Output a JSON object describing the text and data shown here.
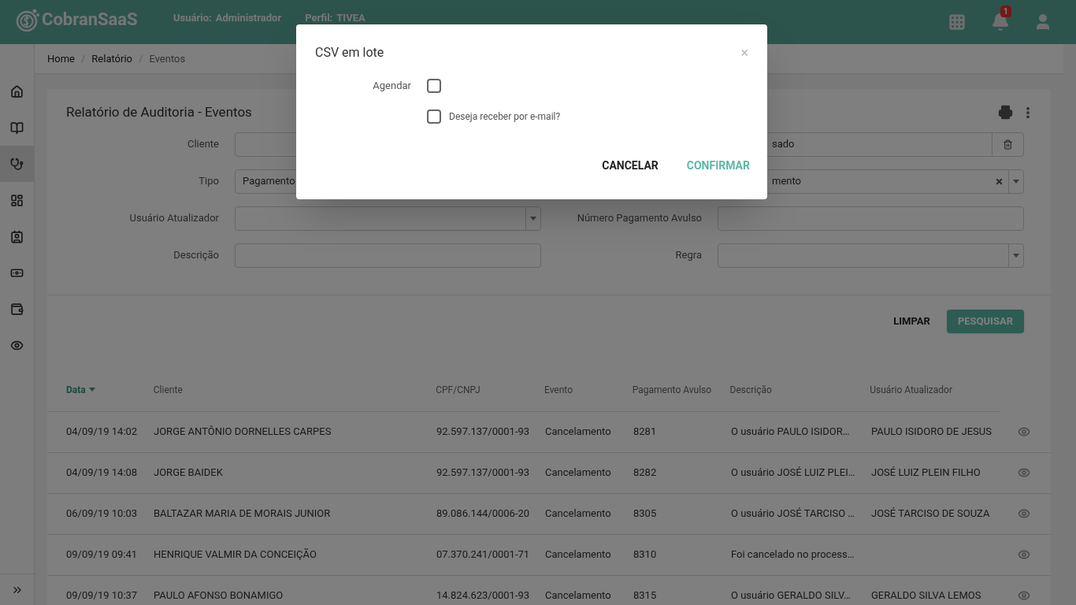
{
  "header": {
    "logo": "CobranSaaS",
    "user_label": "Usuário:",
    "user_value": "Administrador",
    "profile_label": "Perfil:",
    "profile_value": "TIVEA",
    "notification_count": "1"
  },
  "sidebar": {
    "items": [
      {
        "selected": false
      },
      {
        "selected": false
      },
      {
        "selected": true
      },
      {
        "selected": false
      },
      {
        "selected": false
      },
      {
        "selected": false
      },
      {
        "selected": false
      },
      {
        "selected": false
      }
    ]
  },
  "breadcrumb": {
    "separator": "/",
    "items": [
      "Home",
      "Relatório",
      "Eventos"
    ]
  },
  "card": {
    "title": "Relatório de Auditoria - Eventos"
  },
  "filters": [
    {
      "label": "Cliente",
      "kind": "text"
    },
    {
      "value": "sado",
      "kind": "removable"
    },
    {
      "label": "Tipo",
      "value": "Pagamento",
      "kind": "select"
    },
    {
      "value": "mento",
      "kind": "clearable_select"
    },
    {
      "label": "Usuário Atualizador",
      "kind": "select"
    },
    {
      "label": "Número Pagamento Avulso",
      "kind": "text"
    },
    {
      "label": "Descrição",
      "kind": "text"
    },
    {
      "label": "Regra",
      "kind": "select"
    }
  ],
  "actions": [
    {
      "label": "LIMPAR",
      "kind": "flat"
    },
    {
      "label": "PESQUISAR",
      "kind": "raised"
    }
  ],
  "table": {
    "columns": [
      {
        "label": "Data",
        "sorted": true
      },
      {
        "label": "Cliente",
        "sorted": false
      },
      {
        "label": "CPF/CNPJ",
        "sorted": false
      },
      {
        "label": "Evento",
        "sorted": false
      },
      {
        "label": "Pagamento Avulso",
        "sorted": false
      },
      {
        "label": "Descrição",
        "sorted": false
      },
      {
        "label": "Usuário Atualizador",
        "sorted": false
      }
    ],
    "rows": [
      [
        "04/09/19 14:02",
        "JORGE ANTÔNIO DORNELLES CARPES",
        "92.597.137/0001-93",
        "Cancelamento",
        "8281",
        "O usuário PAULO ISIDOR…",
        "PAULO ISIDORO DE JESUS"
      ],
      [
        "04/09/19 14:08",
        "JORGE BAIDEK",
        "92.597.137/0001-93",
        "Cancelamento",
        "8282",
        "O usuário JOSÉ LUIZ PLEI…",
        "JOSÉ LUIZ PLEIN FILHO"
      ],
      [
        "06/09/19 10:03",
        "BALTAZAR MARIA DE MORAIS JUNIOR",
        "89.086.144/0006-20",
        "Cancelamento",
        "8305",
        "O usuário JOSÉ TARCISO …",
        "JOSÉ TARCISO DE SOUZA"
      ],
      [
        "09/09/19 09:41",
        "HENRIQUE VALMIR DA CONCEIÇÃO",
        "07.370.241/0001-71",
        "Cancelamento",
        "8310",
        "Foi cancelado no process…",
        ""
      ],
      [
        "09/09/19 10:37",
        "PAULO AFONSO BONAMIGO",
        "14.824.623/0001-93",
        "Cancelamento",
        "8315",
        "O usuário GERALDO SILV…",
        "GERALDO SILVA LEMOS"
      ]
    ]
  },
  "modal": {
    "title": "CSV em lote",
    "close": "×",
    "options": [
      {
        "label": "Agendar",
        "kind": "labeled",
        "checked": false
      },
      {
        "label": "Deseja receber por e-mail?",
        "kind": "inline",
        "checked": false
      }
    ],
    "buttons": [
      {
        "label": "CANCELAR",
        "kind": "default"
      },
      {
        "label": "CONFIRMAR",
        "kind": "primary"
      }
    ]
  }
}
